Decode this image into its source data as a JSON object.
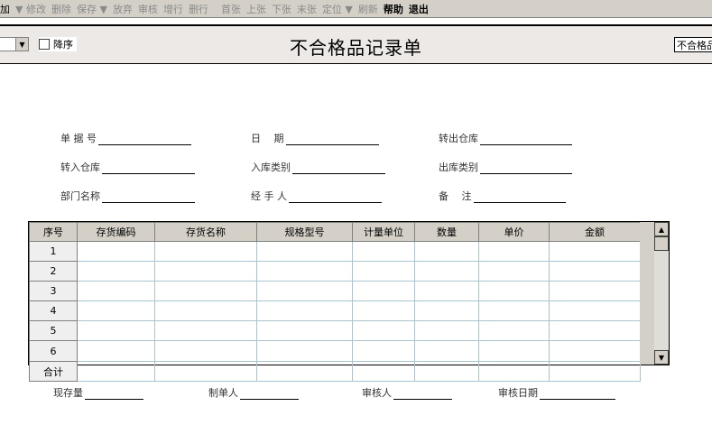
{
  "toolbar": {
    "items": [
      {
        "label": "加",
        "state": "normal"
      },
      {
        "label": "▼ 修改",
        "state": "disabled"
      },
      {
        "label": "删除",
        "state": "disabled"
      },
      {
        "label": "保存 ▼",
        "state": "disabled"
      },
      {
        "label": "放弃",
        "state": "disabled"
      },
      {
        "label": "审核",
        "state": "disabled"
      },
      {
        "label": "增行",
        "state": "disabled"
      },
      {
        "label": "删行",
        "state": "disabled"
      },
      {
        "label": "首张",
        "state": "disabled"
      },
      {
        "label": "上张",
        "state": "disabled"
      },
      {
        "label": "下张",
        "state": "disabled"
      },
      {
        "label": "末张",
        "state": "disabled"
      },
      {
        "label": "定位 ▼",
        "state": "disabled"
      },
      {
        "label": "刷新",
        "state": "disabled"
      },
      {
        "label": "帮助",
        "state": "active"
      },
      {
        "label": "退出",
        "state": "active"
      }
    ]
  },
  "header": {
    "sort_label": "降序",
    "title": "不合格品记录单",
    "right_box": "不合格品"
  },
  "form": {
    "doc_no": "单 据 号",
    "date": "日　 期",
    "out_warehouse": "转出仓库",
    "in_warehouse": "转入仓库",
    "in_type": "入库类别",
    "out_type": "出库类别",
    "dept": "部门名称",
    "handler": "经 手 人",
    "remark": "备　 注"
  },
  "table": {
    "columns": [
      "序号",
      "存货编码",
      "存货名称",
      "规格型号",
      "计量单位",
      "数量",
      "单价",
      "金额"
    ],
    "rows": [
      "1",
      "2",
      "3",
      "4",
      "5",
      "6"
    ],
    "total": "合计"
  },
  "footer": {
    "stock": "现存量",
    "maker": "制单人",
    "reviewer": "审核人",
    "review_date": "审核日期"
  }
}
